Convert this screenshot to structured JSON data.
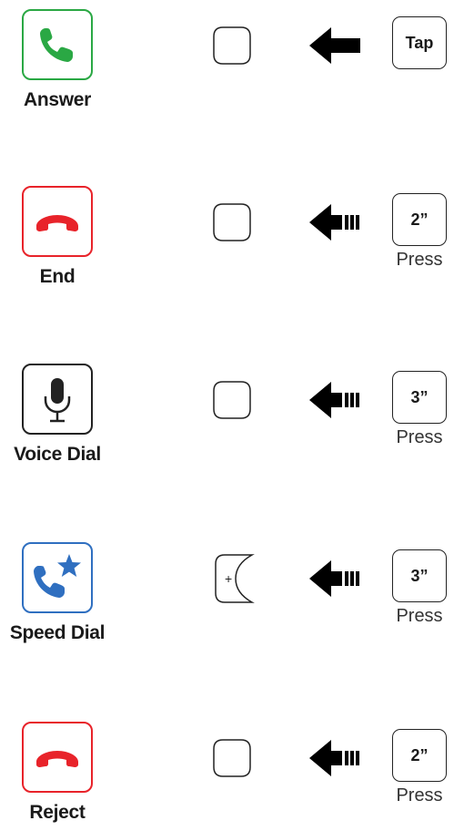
{
  "colors": {
    "answer": "#2aa844",
    "end": "#e8232a",
    "voice": "#222222",
    "speed": "#2f6fc0",
    "reject": "#e8232a"
  },
  "rows": [
    {
      "label": "Answer",
      "icon": "phone-icon",
      "button": "round-button",
      "arrow": "arrow-tap",
      "key_text": "Tap",
      "sub_text": ""
    },
    {
      "label": "End",
      "icon": "hang-up-icon",
      "button": "round-button",
      "arrow": "arrow-hold",
      "key_text": "2”",
      "sub_text": "Press"
    },
    {
      "label": "Voice Dial",
      "icon": "microphone-icon",
      "button": "round-button",
      "arrow": "arrow-hold",
      "key_text": "3”",
      "sub_text": "Press"
    },
    {
      "label": "Speed Dial",
      "icon": "speed-dial-icon",
      "button": "plus-button",
      "button_symbol": "+",
      "arrow": "arrow-hold",
      "key_text": "3”",
      "sub_text": "Press"
    },
    {
      "label": "Reject",
      "icon": "hang-up-icon",
      "button": "round-button",
      "arrow": "arrow-hold",
      "key_text": "2”",
      "sub_text": "Press"
    }
  ]
}
